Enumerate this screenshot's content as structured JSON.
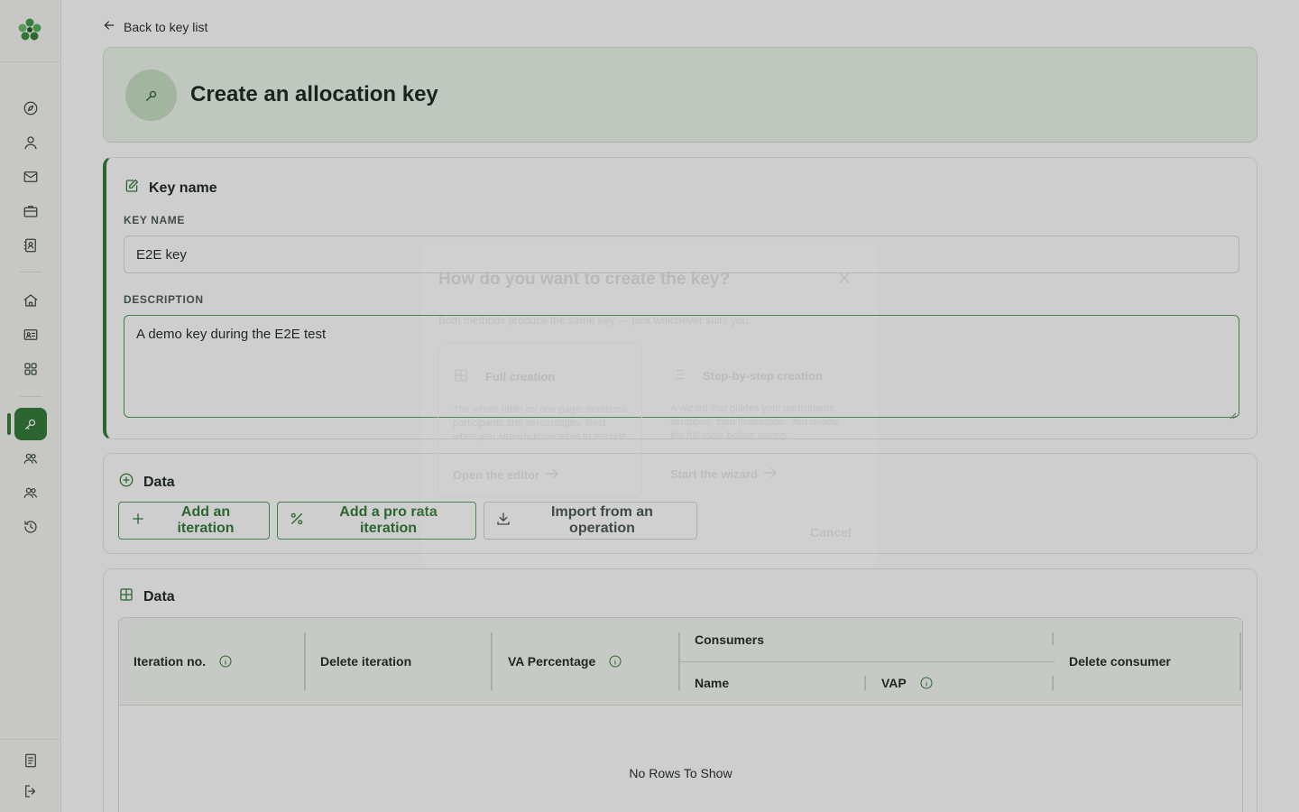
{
  "nav": {
    "back_label": "Back to key list"
  },
  "header": {
    "title": "Create an allocation key"
  },
  "key_section": {
    "title": "Key name",
    "key_name_label": "KEY NAME",
    "key_name_value": "E2E key",
    "description_label": "DESCRIPTION",
    "description_value": "A demo key during the E2E test"
  },
  "data_actions": {
    "title": "Data",
    "add_iteration": "Add an iteration",
    "add_pro_rata": "Add a pro rata iteration",
    "import_operation": "Import from an operation"
  },
  "data_table": {
    "title": "Data",
    "columns": {
      "iteration_no": "Iteration no.",
      "delete_iteration": "Delete iteration",
      "va_percentage": "VA Percentage",
      "consumers": "Consumers",
      "name": "Name",
      "vap": "VAP",
      "delete_consumer": "Delete consumer"
    },
    "empty_text": "No Rows To Show"
  },
  "modal": {
    "title": "How do you want to create the key?",
    "subtitle": "Both methods produce the same key — pick whichever suits you.",
    "options": [
      {
        "title": "Full creation",
        "description": "The whole table on one page: iterations, participants and percentages. Best when you already know what to encode.",
        "link": "Open the editor"
      },
      {
        "title": "Step-by-step creation",
        "description": "A wizard that guides you: participants, iterations, then finalisation. You review the full table before saving.",
        "link": "Start the wizard"
      }
    ],
    "cancel": "Cancel"
  },
  "colors": {
    "accent": "#2f7a37",
    "header_bg": "#eef6ec",
    "overlay": "rgba(30,30,30,0.22)"
  }
}
